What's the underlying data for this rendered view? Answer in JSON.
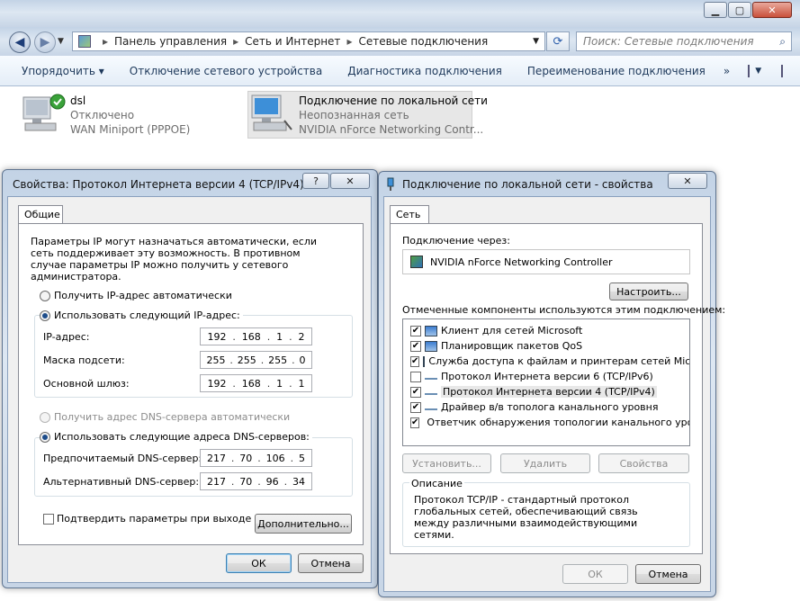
{
  "explorer": {
    "address_parts": [
      "Панель управления",
      "Сеть и Интернет",
      "Сетевые подключения"
    ],
    "search_placeholder": "Поиск: Сетевые подключения",
    "toolbar": {
      "organize": "Упорядочить ▾",
      "disable": "Отключение сетевого устройства",
      "diagnose": "Диагностика подключения",
      "rename": "Переименование подключения",
      "more": "»"
    },
    "connections": [
      {
        "name": "dsl",
        "status": "Отключено",
        "device": "WAN Miniport (PPPOE)"
      },
      {
        "name": "Подключение по локальной сети",
        "status": "Неопознанная сеть",
        "device": "NVIDIA nForce Networking Contr..."
      }
    ]
  },
  "ipv4_dialog": {
    "title": "Свойства: Протокол Интернета версии 4 (TCP/IPv4)",
    "help": "?",
    "close": "✕",
    "tab": "Общие",
    "intro": "Параметры IP могут назначаться автоматически, если сеть поддерживает эту возможность. В противном случае параметры IP можно получить у сетевого администратора.",
    "radio_auto_ip": "Получить IP-адрес автоматически",
    "radio_manual_ip": "Использовать следующий IP-адрес:",
    "ip_label": "IP-адрес:",
    "ip_value": [
      "192",
      "168",
      "1",
      "2"
    ],
    "mask_label": "Маска подсети:",
    "mask_value": [
      "255",
      "255",
      "255",
      "0"
    ],
    "gateway_label": "Основной шлюз:",
    "gateway_value": [
      "192",
      "168",
      "1",
      "1"
    ],
    "radio_auto_dns": "Получить адрес DNS-сервера автоматически",
    "radio_manual_dns": "Использовать следующие адреса DNS-серверов:",
    "dns1_label": "Предпочитаемый DNS-сервер:",
    "dns1_value": [
      "217",
      "70",
      "106",
      "5"
    ],
    "dns2_label": "Альтернативный DNS-сервер:",
    "dns2_value": [
      "217",
      "70",
      "96",
      "34"
    ],
    "validate_label": "Подтвердить параметры при выходе",
    "advanced": "Дополнительно...",
    "ok": "ОК",
    "cancel": "Отмена"
  },
  "lan_dialog": {
    "title": "Подключение по локальной сети - свойства",
    "close": "✕",
    "tab": "Сеть",
    "connect_using": "Подключение через:",
    "adapter": "NVIDIA nForce Networking Controller",
    "configure": "Настроить...",
    "components_label": "Отмеченные компоненты используются этим подключением:",
    "components": [
      {
        "label": "Клиент для сетей Microsoft",
        "checked": true
      },
      {
        "label": "Планировщик пакетов QoS",
        "checked": true
      },
      {
        "label": "Служба доступа к файлам и принтерам сетей Micro...",
        "checked": true
      },
      {
        "label": "Протокол Интернета версии 6 (TCP/IPv6)",
        "checked": false
      },
      {
        "label": "Протокол Интернета версии 4 (TCP/IPv4)",
        "checked": true
      },
      {
        "label": "Драйвер в/в тополога канального уровня",
        "checked": true
      },
      {
        "label": "Ответчик обнаружения топологии канального уровня",
        "checked": true
      }
    ],
    "install": "Установить...",
    "uninstall": "Удалить",
    "properties": "Свойства",
    "desc_title": "Описание",
    "description": "Протокол TCP/IP - стандартный протокол глобальных сетей, обеспечивающий связь между различными взаимодействующими сетями.",
    "ok": "ОК",
    "cancel": "Отмена"
  }
}
